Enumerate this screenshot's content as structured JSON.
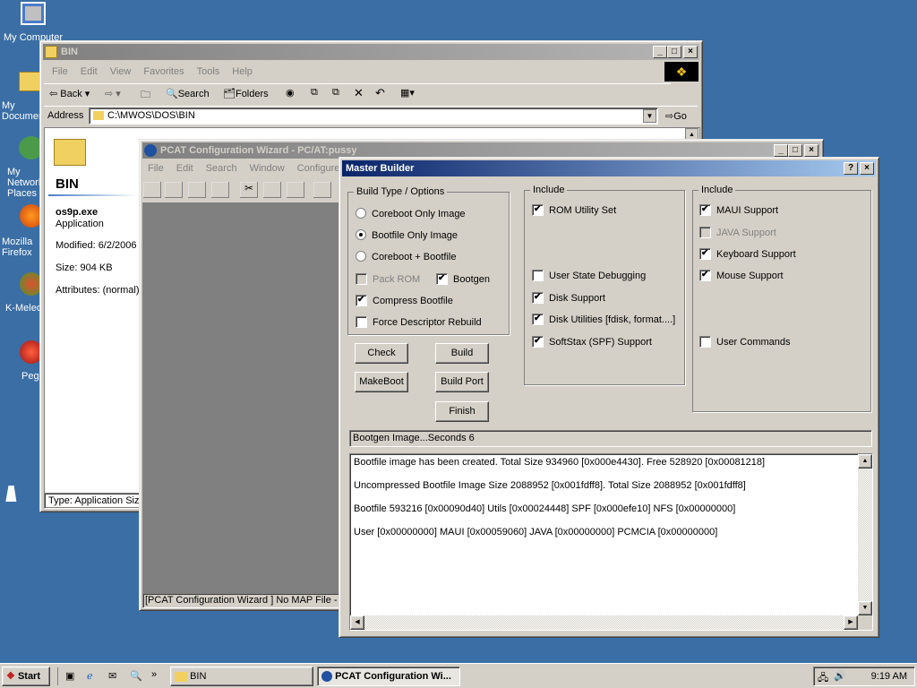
{
  "desktop": {
    "icons": [
      {
        "label": "My Computer"
      },
      {
        "label": "My Documents"
      },
      {
        "label": "My Network Places"
      },
      {
        "label": "Mozilla Firefox"
      },
      {
        "label": "K-Meleon"
      },
      {
        "label": "Pegasus"
      }
    ]
  },
  "explorer": {
    "title": "BIN",
    "menu": [
      "File",
      "Edit",
      "View",
      "Favorites",
      "Tools",
      "Help"
    ],
    "toolbar": {
      "back": "Back",
      "search": "Search",
      "folders": "Folders"
    },
    "address_label": "Address",
    "address_value": "C:\\MWOS\\DOS\\BIN",
    "go": "Go",
    "folder_name": "BIN",
    "file": {
      "name": "os9p.exe",
      "type": "Application",
      "modified": "Modified: 6/2/2006",
      "size": "Size: 904 KB",
      "attributes": "Attributes: (normal)"
    },
    "status": "Type: Application Size"
  },
  "wizard": {
    "title": "PCAT Configuration Wizard  - PC/AT:pussy",
    "menu": [
      "File",
      "Edit",
      "Search",
      "Window",
      "Configure",
      "S"
    ],
    "status": "[PCAT Configuration Wizard ] No MAP File - Us"
  },
  "master": {
    "title": "Master Builder",
    "build_group": "Build Type / Options",
    "radios": [
      {
        "label": "Coreboot Only Image",
        "on": false
      },
      {
        "label": "Bootfile Only Image",
        "on": true
      },
      {
        "label": "Coreboot + Bootfile",
        "on": false
      }
    ],
    "pack_rom": "Pack ROM",
    "bootgen": "Bootgen",
    "compress": "Compress Bootfile",
    "force": "Force Descriptor Rebuild",
    "include1_label": "Include",
    "include1": {
      "rom": "ROM Utility Set",
      "user_state": "User State Debugging",
      "disk": "Disk Support",
      "disk_util": "Disk Utilities [fdisk, format....]",
      "softstax": "SoftStax (SPF) Support"
    },
    "include2_label": "Include",
    "include2": {
      "maui": "MAUI Support",
      "java": "JAVA Support",
      "keyboard": "Keyboard Support",
      "mouse": "Mouse Support",
      "user_cmds": "User Commands"
    },
    "buttons": {
      "check": "Check",
      "build": "Build",
      "makeboot": "MakeBoot",
      "build_port": "Build Port",
      "finish": "Finish"
    },
    "progress": "Bootgen Image...Seconds 6",
    "log": [
      "Bootfile image has been created. Total Size 934960 [0x000e4430]. Free 528920 [0x00081218]",
      "Uncompressed Bootfile Image Size 2088952 [0x001fdff8]. Total Size 2088952 [0x001fdff8]",
      "Bootfile 593216 [0x00090d40] Utils [0x00024448] SPF [0x000efe10] NFS [0x00000000]",
      "User [0x00000000] MAUI [0x00059060] JAVA [0x00000000] PCMCIA [0x00000000]"
    ]
  },
  "taskbar": {
    "start": "Start",
    "tasks": [
      "BIN",
      "PCAT Configuration Wi..."
    ],
    "clock": "9:19 AM"
  }
}
